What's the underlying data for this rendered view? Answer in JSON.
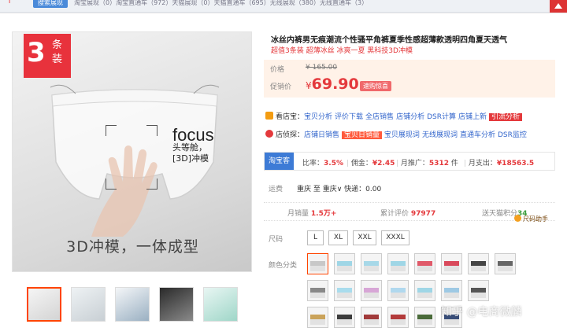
{
  "topbar": {
    "badge": "搜索展现",
    "crumbs": "淘宝展现（0）淘宝直通车（972）天猫展现（0）天猫直通车（695）无线展现（380）无线直通车（3）"
  },
  "product_image": {
    "badge_number": "3",
    "badge_word": "条装",
    "focus": "focus",
    "focus_sub_line1": "头等舱，",
    "focus_sub_line2": "[3D]冲模",
    "slogan": "3D冲模，一体成型"
  },
  "title": "冰丝内裤男无痕潮流个性骚平角裤夏季性感超薄款透明四角夏天透气",
  "subtitle": "超值3条装 超薄冰丝 冰爽一夏 黑科技3D冲模",
  "price": {
    "original_label": "价格",
    "original": "¥ 165.00",
    "promo_label": "促销价",
    "currency": "¥",
    "promo": "69.90",
    "tag": "速购惊喜"
  },
  "shop_tools": {
    "label": "看店宝：",
    "links": [
      "宝贝分析",
      "评价下载",
      "全店销售",
      "店铺分析",
      "DSR计算",
      "店铺上新"
    ],
    "highlight": "引流分析"
  },
  "shop_detective": {
    "label": "店侦探：",
    "links_before": [
      "店铺日销售"
    ],
    "highlight": "宝贝日销量",
    "links_after": [
      "宝贝展现词",
      "无线展现词",
      "直通车分析",
      "DSR监控"
    ]
  },
  "stats": {
    "tab": "淘宝客",
    "ratio_label": "比率：",
    "ratio": "3.5%",
    "commission_label": "佣金：",
    "commission": "¥2.45",
    "monthly_promo_label": "月推广：",
    "monthly_promo": "5312",
    "monthly_promo_unit": "件",
    "monthly_spend_label": "月支出：",
    "monthly_spend": "¥18563.5"
  },
  "shipping": {
    "label": "运费",
    "value": "重庆 至 重庆∨  快递：0.00"
  },
  "sales": {
    "monthly_label": "月销量",
    "monthly": "1.5万+",
    "reviews_label": "累计评价",
    "reviews": "97977",
    "points_label": "送天猫积分",
    "points": "34",
    "helper": "尺码助手"
  },
  "size": {
    "label": "尺码",
    "options": [
      "L",
      "XL",
      "XXL",
      "XXXL"
    ]
  },
  "color": {
    "label": "颜色分类",
    "swatch_bands": [
      "#c8c8c8",
      "#9fd6e6",
      "#a7d8e8",
      "#9fd6e6",
      "#e05a6a",
      "#d94a5c",
      "#444444",
      "#666666",
      "#888888",
      "#a9dced",
      "#d7a6d6",
      "#b0d8ee",
      "#9fd6e6",
      "#9ec9e4",
      "#555555",
      "#caa35a",
      "#3c3c3c",
      "#a13a3a",
      "#b33b3b",
      "#4a6b3a",
      "#3a4f7a"
    ],
    "accent": "#f40"
  },
  "watermark": "知乎 @电商微麟"
}
